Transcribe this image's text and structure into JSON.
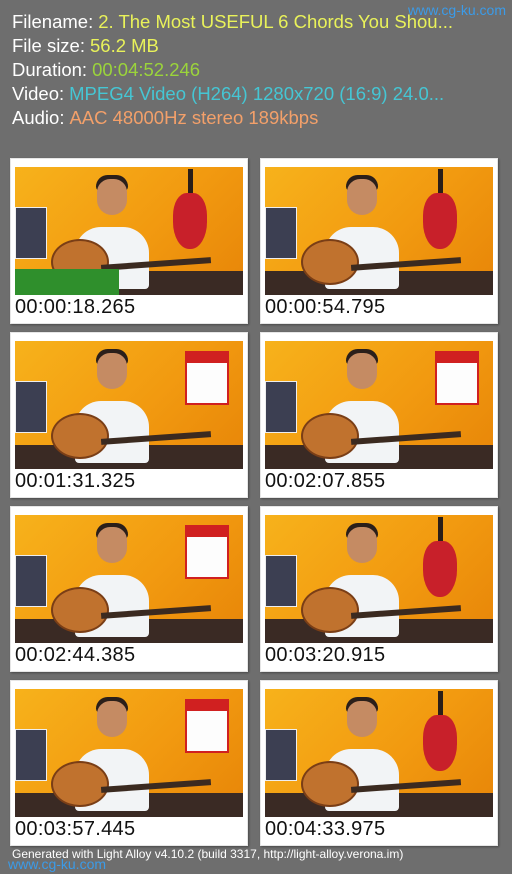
{
  "info": {
    "filename_label": "Filename:",
    "filename_value": "2. The Most USEFUL 6 Chords You Shou...",
    "filesize_label": "File size:",
    "filesize_value": "56.2 MB",
    "duration_label": "Duration:",
    "duration_value": "00:04:52.246",
    "video_label": "Video:",
    "video_value": "MPEG4 Video (H264) 1280x720 (16:9) 24.0...",
    "audio_label": "Audio:",
    "audio_value": "AAC 48000Hz stereo 189kbps"
  },
  "colors": {
    "filename": "#e9f25a",
    "filesize": "#e9f25a",
    "duration": "#9bd43b",
    "video": "#45c6d4",
    "audio": "#f3a06a"
  },
  "watermark_top": "www.cg-ku.com",
  "watermark_bottom": "www.cg-ku.com",
  "thumbnails": [
    {
      "time": "00:00:18.265"
    },
    {
      "time": "00:00:54.795"
    },
    {
      "time": "00:01:31.325"
    },
    {
      "time": "00:02:07.855"
    },
    {
      "time": "00:02:44.385"
    },
    {
      "time": "00:03:20.915"
    },
    {
      "time": "00:03:57.445"
    },
    {
      "time": "00:04:33.975"
    }
  ],
  "footer": "Generated with Light Alloy v4.10.2 (build 3317, http://light-alloy.verona.im)"
}
